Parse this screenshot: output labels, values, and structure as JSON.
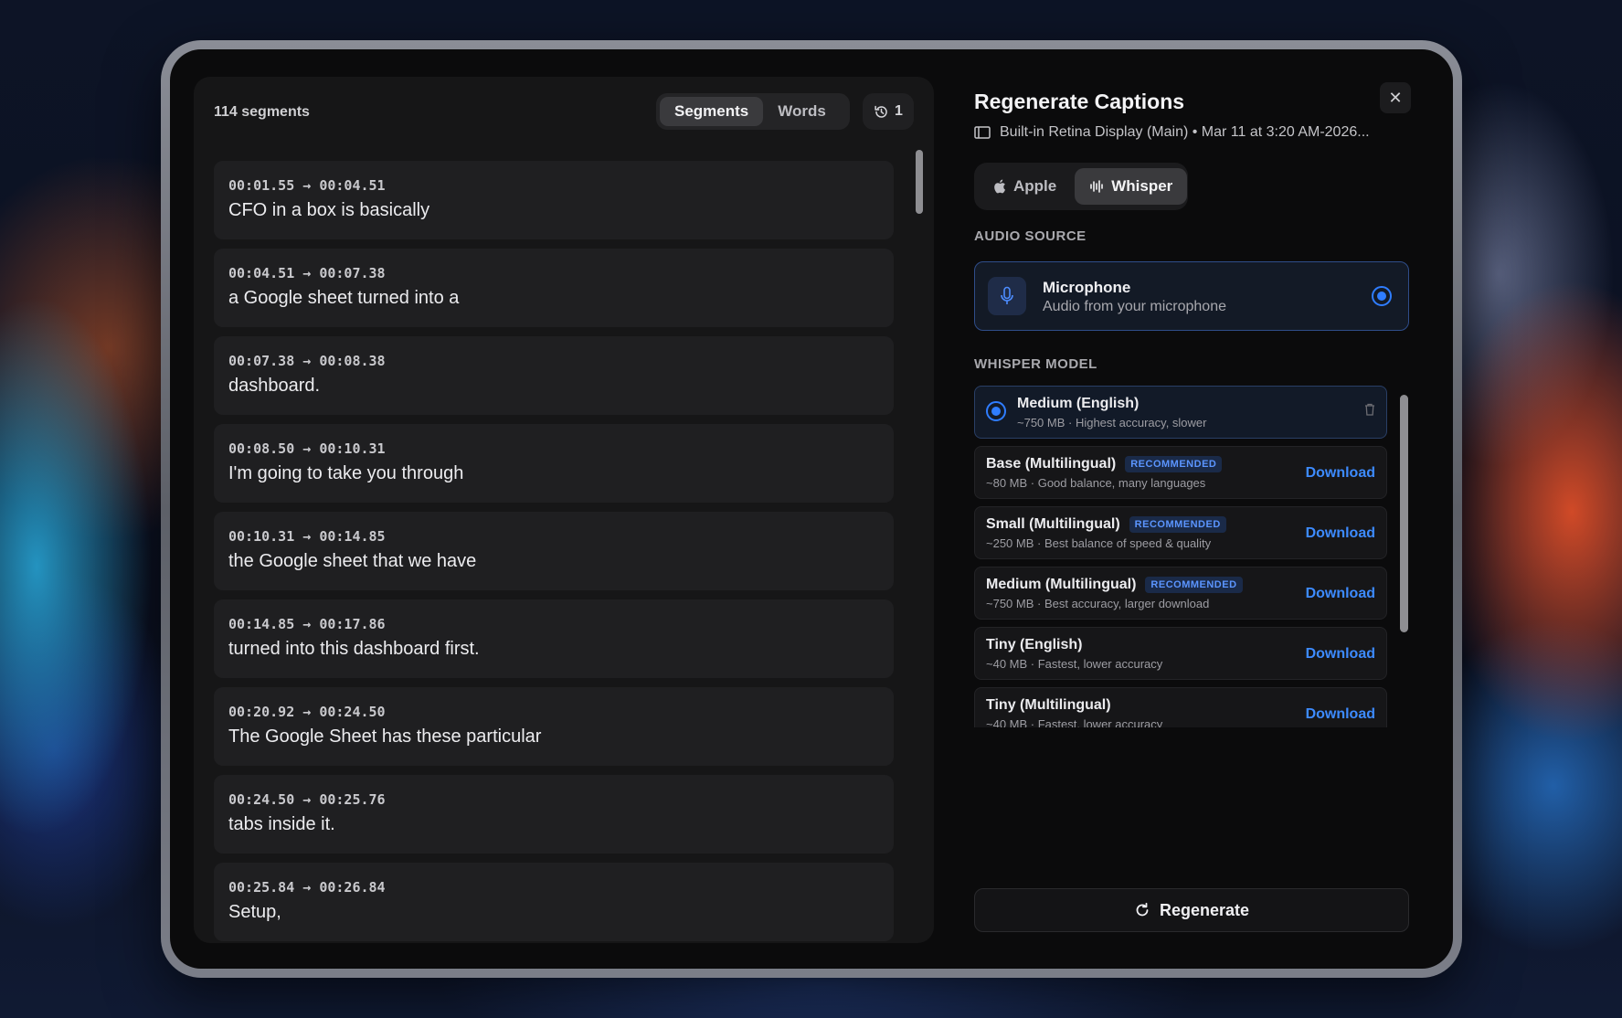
{
  "transcript": {
    "segment_count": "114 segments",
    "view_toggle": {
      "segments": "Segments",
      "words": "Words"
    },
    "history_count": "1",
    "segments": [
      {
        "time": "00:01.55 → 00:04.51",
        "text": "CFO in a box is basically"
      },
      {
        "time": "00:04.51 → 00:07.38",
        "text": "a Google sheet turned into a"
      },
      {
        "time": "00:07.38 → 00:08.38",
        "text": "dashboard."
      },
      {
        "time": "00:08.50 → 00:10.31",
        "text": "I'm going to take you through"
      },
      {
        "time": "00:10.31 → 00:14.85",
        "text": "the Google sheet that we have"
      },
      {
        "time": "00:14.85 → 00:17.86",
        "text": "turned into this dashboard first."
      },
      {
        "time": "00:20.92 → 00:24.50",
        "text": "The Google Sheet has these particular"
      },
      {
        "time": "00:24.50 → 00:25.76",
        "text": "tabs inside it."
      },
      {
        "time": "00:25.84 → 00:26.84",
        "text": "Setup,"
      }
    ]
  },
  "panel": {
    "title": "Regenerate Captions",
    "subtitle": "Built-in Retina Display (Main) • Mar 11 at 3:20 AM-2026...",
    "engines": {
      "apple": "Apple",
      "whisper": "Whisper"
    },
    "audio_source_label": "AUDIO SOURCE",
    "audio_source": {
      "name": "Microphone",
      "description": "Audio from your microphone"
    },
    "whisper_model_label": "WHISPER MODEL",
    "models": [
      {
        "name": "Medium (English)",
        "description": "~750 MB · Highest accuracy, slower",
        "badge": "",
        "action": ""
      },
      {
        "name": "Base (Multilingual)",
        "description": "~80 MB · Good balance, many languages",
        "badge": "RECOMMENDED",
        "action": "Download"
      },
      {
        "name": "Small (Multilingual)",
        "description": "~250 MB · Best balance of speed & quality",
        "badge": "RECOMMENDED",
        "action": "Download"
      },
      {
        "name": "Medium (Multilingual)",
        "description": "~750 MB · Best accuracy, larger download",
        "badge": "RECOMMENDED",
        "action": "Download"
      },
      {
        "name": "Tiny (English)",
        "description": "~40 MB · Fastest, lower accuracy",
        "badge": "",
        "action": "Download"
      },
      {
        "name": "Tiny (Multilingual)",
        "description": "~40 MB · Fastest, lower accuracy",
        "badge": "",
        "action": "Download"
      }
    ],
    "regenerate_label": "Regenerate"
  },
  "icons": {
    "history": "clock-history-icon",
    "close": "close-icon",
    "display": "display-icon",
    "apple": "apple-logo-icon",
    "whisper": "waveform-icon",
    "mic": "microphone-icon",
    "trash": "trash-icon",
    "regenerate": "refresh-icon"
  },
  "colors": {
    "accent": "#2f7dff",
    "link": "#3d8bff"
  }
}
